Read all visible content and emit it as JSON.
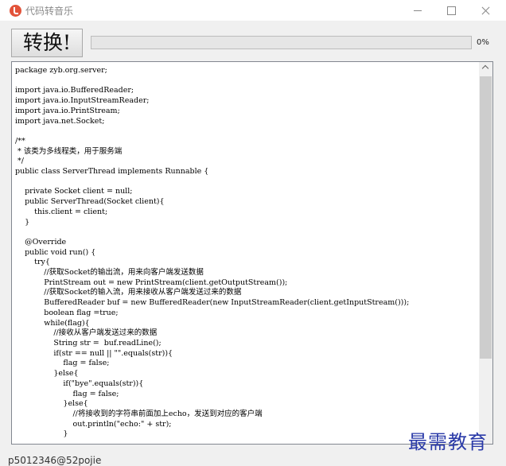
{
  "window": {
    "title": "代码转音乐",
    "icon": "music-note-icon"
  },
  "toolbar": {
    "convert_label": "转换!",
    "progress_label": "0%",
    "progress_value": 0,
    "progress_color": "#06b025"
  },
  "editor": {
    "code": "package zyb.org.server;\n\nimport java.io.BufferedReader;\nimport java.io.InputStreamReader;\nimport java.io.PrintStream;\nimport java.net.Socket;\n\n/**\n * 该类为多线程类，用于服务端\n */\npublic class ServerThread implements Runnable {\n\n    private Socket client = null;\n    public ServerThread(Socket client){\n        this.client = client;\n    }\n\n    @Override\n    public void run() {\n        try{\n            //获取Socket的输出流，用来向客户端发送数据\n            PrintStream out = new PrintStream(client.getOutputStream());\n            //获取Socket的输入流，用来接收从客户端发送过来的数据\n            BufferedReader buf = new BufferedReader(new InputStreamReader(client.getInputStream()));\n            boolean flag =true;\n            while(flag){\n                //接收从客户端发送过来的数据\n                String str =  buf.readLine();\n                if(str == null || \"\".equals(str)){\n                    flag = false;\n                }else{\n                    if(\"bye\".equals(str)){\n                        flag = false;\n                    }else{\n                        //将接收到的字符串前面加上echo，发送到对应的客户端\n                        out.println(\"echo:\" + str);\n                    }"
  },
  "watermark": "最需教育",
  "footer": {
    "author": "p5012346@52pojie"
  }
}
